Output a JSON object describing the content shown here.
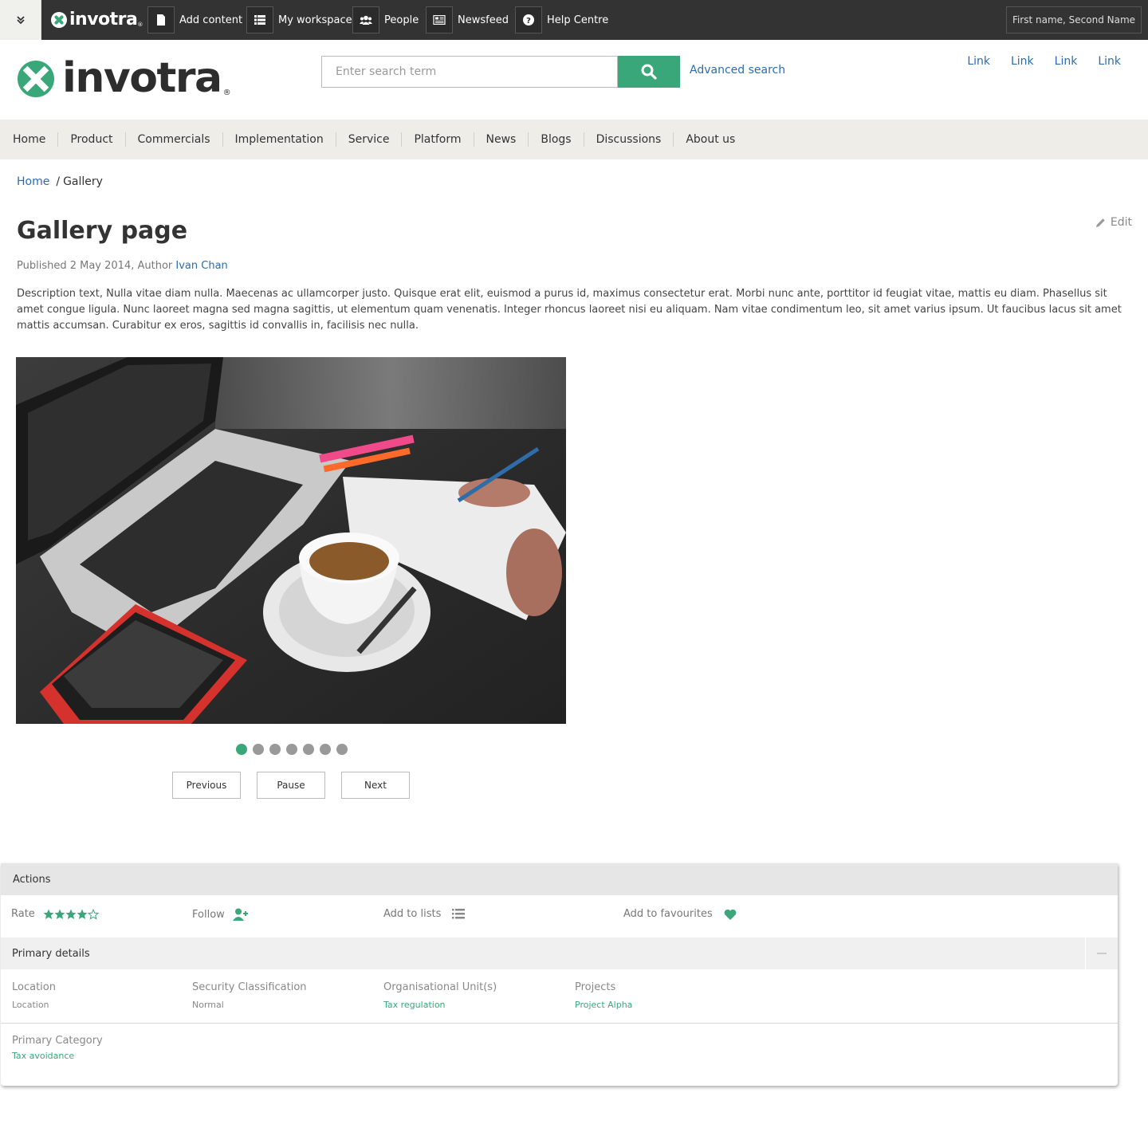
{
  "topbar": {
    "logo_text": "invotra",
    "items": [
      {
        "label": "Add content",
        "icon": "document-icon"
      },
      {
        "label": "My workspace",
        "icon": "list-icon"
      },
      {
        "label": "People",
        "icon": "people-icon"
      },
      {
        "label": "Newsfeed",
        "icon": "newspaper-icon"
      },
      {
        "label": "Help Centre",
        "icon": "question-icon"
      }
    ],
    "user_name": "First name, Second Name"
  },
  "header": {
    "logo_text": "invotra",
    "search_placeholder": "Enter search term",
    "advanced_search": "Advanced search",
    "links": [
      "Link",
      "Link",
      "Link",
      "Link"
    ]
  },
  "nav": [
    "Home",
    "Product",
    "Commercials",
    "Implementation",
    "Service",
    "Platform",
    "News",
    "Blogs",
    "Discussions",
    "About us"
  ],
  "breadcrumb": {
    "home": "Home",
    "separator": "/",
    "current": "Gallery"
  },
  "page": {
    "title": "Gallery page",
    "edit_label": "Edit",
    "published": "Published 2 May 2014, Author",
    "author": "Ivan Chan",
    "description": "Description text, Nulla vitae diam nulla. Maecenas ac ullamcorper justo. Quisque erat elit, euismod a purus id, maximus consectetur erat. Morbi nunc ante, porttitor id feugiat vitae, mattis eu diam. Phasellus sit amet congue ligula. Nunc laoreet magna sed magna sagittis, ut elementum quam venenatis. Integer rhoncus laoreet nisi eu aliquam. Nam vitae condimentum leo, sit amet varius ipsum. Ut faucibus lacus sit amet mattis accumsan. Curabitur ex eros, sagittis id convallis in, facilisis nec nulla."
  },
  "gallery": {
    "slide_count": 7,
    "active_slide": 1,
    "previous": "Previous",
    "pause": "Pause",
    "next": "Next"
  },
  "actions": {
    "heading": "Actions",
    "rate_label": "Rate",
    "rating": 4,
    "rating_max": 5,
    "follow": "Follow",
    "add_to_lists": "Add to lists",
    "add_to_favourites": "Add to favourites"
  },
  "primary_details": {
    "heading": "Primary details",
    "fields": [
      {
        "label": "Location",
        "value": "Location"
      },
      {
        "label": "Security Classification",
        "value": "Normal"
      },
      {
        "label": "Organisational Unit(s)",
        "value": "Tax regulation"
      },
      {
        "label": "Projects",
        "value": "Project Alpha"
      }
    ],
    "category_label": "Primary Category",
    "category_value": "Tax avoidance"
  },
  "colors": {
    "accent": "#3aa77a",
    "link": "#2b6cb0",
    "topbar": "#333333"
  }
}
